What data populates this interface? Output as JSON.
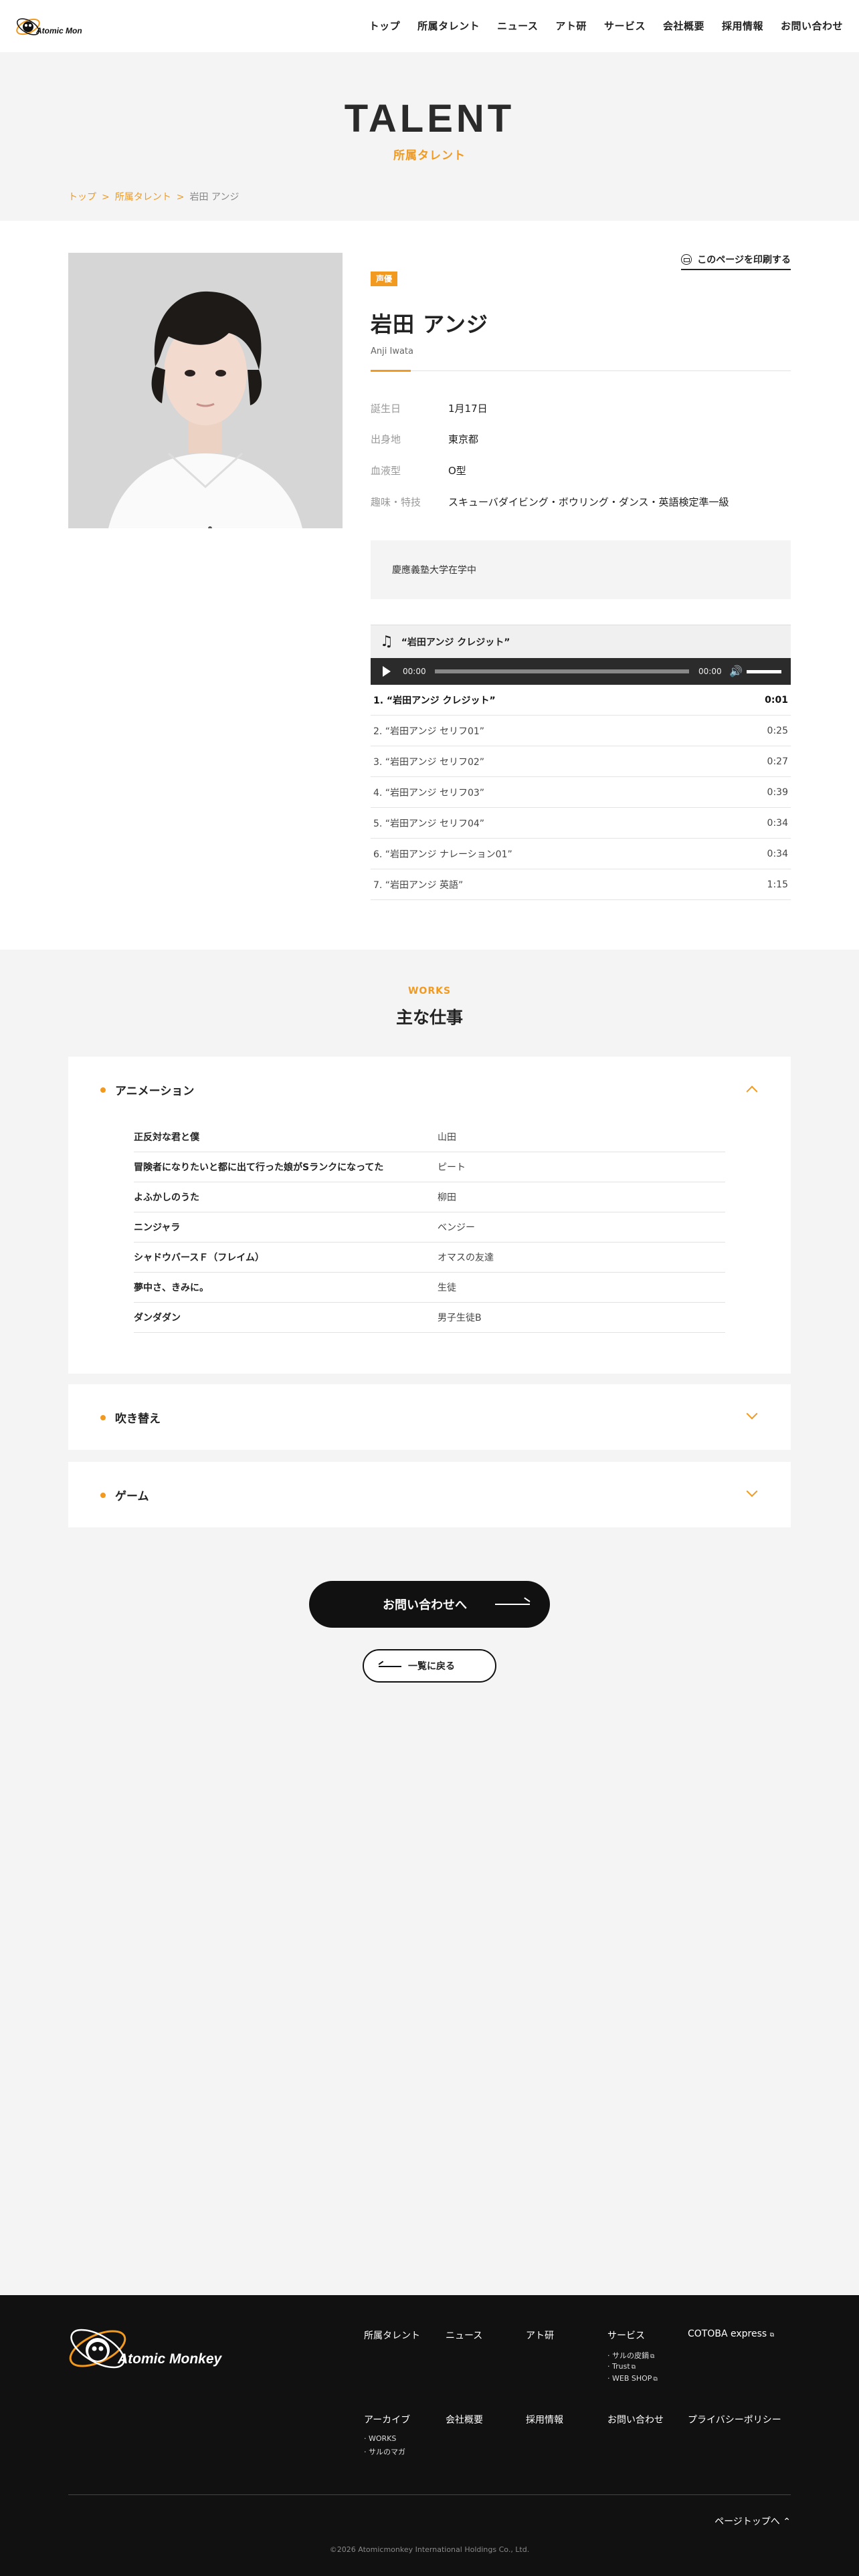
{
  "header": {
    "nav": [
      "トップ",
      "所属タレント",
      "ニュース",
      "アト研",
      "サービス",
      "会社概要",
      "採用情報",
      "お問い合わせ"
    ]
  },
  "hero": {
    "title": "TALENT",
    "subtitle": "所属タレント"
  },
  "breadcrumb": {
    "items": [
      "トップ",
      "所属タレント",
      "岩田 アンジ"
    ],
    "separator": ">"
  },
  "profile": {
    "category_tag": "声優",
    "print_label": "このページを印刷する",
    "name": "岩田 アンジ",
    "name_en": "Anji Iwata",
    "specs": [
      {
        "key": "誕生日",
        "value": "1月17日"
      },
      {
        "key": "出身地",
        "value": "東京都"
      },
      {
        "key": "血液型",
        "value": "O型"
      },
      {
        "key": "趣味・特技",
        "value": "スキューバダイビング・ボウリング・ダンス・英語検定準一級"
      }
    ],
    "note": "慶應義塾大学在学中"
  },
  "player": {
    "title": "“岩田アンジ クレジット”",
    "time_current": "00:00",
    "time_total": "00:00",
    "tracks": [
      {
        "label": "1. “岩田アンジ クレジット”",
        "duration": "0:01"
      },
      {
        "label": "2. “岩田アンジ セリフ01”",
        "duration": "0:25"
      },
      {
        "label": "3. “岩田アンジ セリフ02”",
        "duration": "0:27"
      },
      {
        "label": "4. “岩田アンジ セリフ03”",
        "duration": "0:39"
      },
      {
        "label": "5. “岩田アンジ セリフ04”",
        "duration": "0:34"
      },
      {
        "label": "6. “岩田アンジ ナレーション01”",
        "duration": "0:34"
      },
      {
        "label": "7. “岩田アンジ 英語”",
        "duration": "1:15"
      }
    ]
  },
  "works": {
    "heading_en": "WORKS",
    "heading_ja": "主な仕事",
    "sections": [
      {
        "label": "アニメーション",
        "rows": [
          {
            "title": "正反対な君と僕",
            "role": "山田"
          },
          {
            "title": "冒険者になりたいと都に出て行った娘がSランクになってた",
            "role": "ピート"
          },
          {
            "title": "よふかしのうた",
            "role": "柳田"
          },
          {
            "title": "ニンジャラ",
            "role": "ベンジー"
          },
          {
            "title": "シャドウバースＦ（フレイム）",
            "role": "オマスの友達"
          },
          {
            "title": "夢中さ、きみに。",
            "role": "生徒"
          },
          {
            "title": "ダンダダン",
            "role": "男子生徒B"
          }
        ]
      },
      {
        "label": "吹き替え"
      },
      {
        "label": "ゲーム"
      }
    ]
  },
  "buttons": {
    "contact": "お問い合わせへ",
    "back": "一覧に戻る"
  },
  "footer": {
    "col1": [
      "所属タレント",
      "ニュース",
      "アト研",
      "サービス",
      "COTOBA express"
    ],
    "services_sub": [
      "サルの皮鍋",
      "Trust",
      "WEB SHOP"
    ],
    "col2": [
      "アーカイブ",
      "会社概要",
      "採用情報",
      "お問い合わせ",
      "プライバシーポリシー"
    ],
    "archive_sub": [
      "WORKS",
      "サルのマガ"
    ],
    "pagetop": "ページトップへ",
    "copyright": "©2026 Atomicmonkey International Holdings Co., Ltd."
  },
  "colors": {
    "accent": "#f29a1f",
    "dark": "#111111"
  }
}
